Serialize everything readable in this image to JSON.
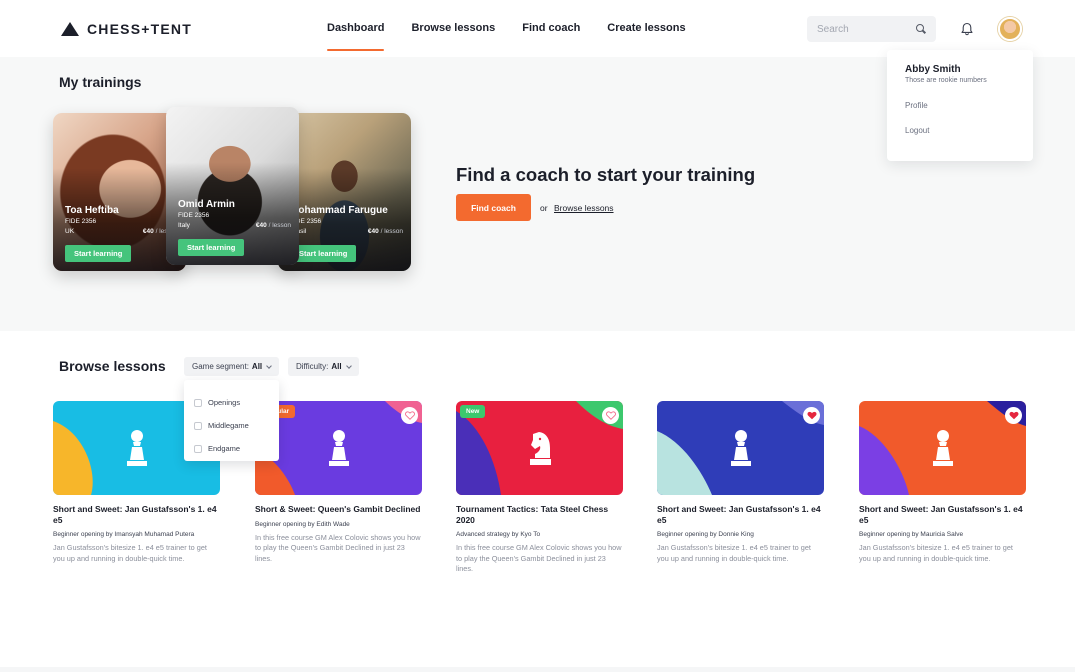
{
  "header": {
    "brand": "CHESS+TENT",
    "nav": [
      {
        "label": "Dashboard",
        "active": true
      },
      {
        "label": "Browse lessons",
        "active": false
      },
      {
        "label": "Find coach",
        "active": false
      },
      {
        "label": "Create lessons",
        "active": false
      }
    ],
    "search_placeholder": "Search"
  },
  "profile_menu": {
    "name": "Abby Smith",
    "subtitle": "Those are rookie numbers",
    "items": [
      "Profile",
      "Logout"
    ]
  },
  "trainings": {
    "title": "My trainings",
    "coaches": [
      {
        "name": "Toa Heftiba",
        "fide": "FIDE 2356",
        "country": "UK",
        "price": "€40",
        "per": "/ lesson",
        "button": "Start learning"
      },
      {
        "name": "Omid Armin",
        "fide": "FIDE 2356",
        "country": "Italy",
        "price": "€40",
        "per": "/ lesson",
        "button": "Start learning"
      },
      {
        "name": "Mohammad Farugue",
        "fide": "FIDE 2356",
        "country": "Brasil",
        "price": "€40",
        "per": "/ lesson",
        "button": "Start learning"
      }
    ],
    "cta_title": "Find a coach to start your training",
    "cta_button": "Find coach",
    "cta_or": "or",
    "cta_link": "Browse lessons"
  },
  "browse": {
    "title": "Browse lessons",
    "filters": [
      {
        "label": "Game segment:",
        "value": "All"
      },
      {
        "label": "Difficulty:",
        "value": "All"
      }
    ],
    "segment_options": [
      "Openings",
      "Middlegame",
      "Endgame"
    ],
    "lessons": [
      {
        "title": "Short and Sweet: Jan Gustafsson's 1. e4 e5",
        "meta": "Beginner opening by Imansyah Muhamad Putera",
        "desc": "Jan Gustafsson's bitesize 1. e4 e5 trainer to get you up and running in double-quick time.",
        "badge": "",
        "favorite": "none",
        "piece": "pawn-icon"
      },
      {
        "title": "Short & Sweet: Queen's Gambit Declined",
        "meta": "Beginner opening by Edith Wade",
        "desc": "In this free course GM Alex Colovic shows you how to play the Queen's Gambit Declined in just 23 lines.",
        "badge": "Popular",
        "favorite": "empty",
        "piece": "pawn-icon"
      },
      {
        "title": "Tournament Tactics: Tata Steel Chess 2020",
        "meta": "Advanced strategy by Kyo To",
        "desc": "In this free course GM Alex Colovic shows you how to play the Queen's Gambit Declined in just 23 lines.",
        "badge": "New",
        "favorite": "empty",
        "piece": "knight-icon"
      },
      {
        "title": "Short and Sweet: Jan Gustafsson's 1. e4 e5",
        "meta": "Beginner opening by Donnie King",
        "desc": "Jan Gustafsson's bitesize 1. e4 e5 trainer to get you up and running in double-quick time.",
        "badge": "",
        "favorite": "filled",
        "piece": "pawn-icon"
      },
      {
        "title": "Short and Sweet: Jan Gustafsson's 1. e4 e5",
        "meta": "Beginner opening by Mauricia Salve",
        "desc": "Jan Gustafsson's bitesize 1. e4 e5 trainer to get you up and running in double-quick time.",
        "badge": "",
        "favorite": "filled",
        "piece": "pawn-icon"
      }
    ]
  },
  "colors": {
    "accent": "#f36a2f",
    "success": "#45c47c",
    "text": "#1c1f2a",
    "heart": "#e5273f"
  }
}
